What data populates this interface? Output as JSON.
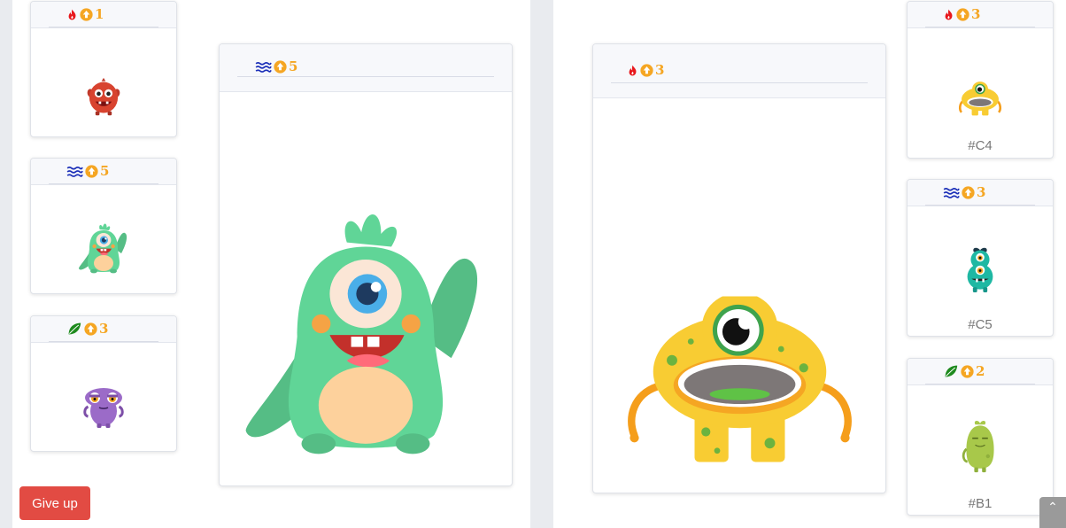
{
  "colors": {
    "fire": "#e8171c",
    "water": "#1b2fb8",
    "leaf": "#1e8a1e",
    "level": "#f5a623",
    "give_up_bg": "#e24b43"
  },
  "left_board": {
    "small_cards": [
      {
        "element": "fire-icon",
        "level": "1",
        "monster": "red monster"
      },
      {
        "element": "water-icon",
        "level": "5",
        "monster": "green cyclops"
      },
      {
        "element": "leaf-icon",
        "level": "3",
        "monster": "purple monster"
      }
    ],
    "big_card": {
      "element": "water-icon",
      "level": "5"
    }
  },
  "right_board": {
    "big_card": {
      "element": "fire-icon",
      "level": "3"
    },
    "small_cards": [
      {
        "element": "fire-icon",
        "level": "3",
        "code": "#C4"
      },
      {
        "element": "water-icon",
        "level": "3",
        "code": "#C5"
      },
      {
        "element": "leaf-icon",
        "level": "2",
        "code": "#B1"
      }
    ]
  },
  "actions": {
    "give_up": "Give up",
    "scroll_top": "⌃"
  }
}
